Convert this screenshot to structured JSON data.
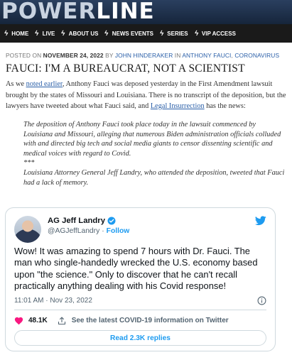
{
  "brand": {
    "part1": "POWER",
    "part2": "LINE"
  },
  "nav": {
    "items": [
      {
        "label": "HOME"
      },
      {
        "label": "LIVE"
      },
      {
        "label": "ABOUT US"
      },
      {
        "label": "NEWS EVENTS"
      },
      {
        "label": "SERIES"
      },
      {
        "label": "VIP ACCESS"
      }
    ]
  },
  "post": {
    "posted_on_prefix": "POSTED ON",
    "date": "NOVEMBER 24, 2022",
    "by": "BY",
    "author": "JOHN HINDERAKER",
    "in": "IN",
    "category1": "ANTHONY FAUCI",
    "comma": ",",
    "category2": "CORONAVIRUS",
    "title": "FAUCI: I'M A BUREAUCRAT, NOT A SCIENTIST",
    "intro_1": "As we",
    "intro_link1": "noted earlier",
    "intro_2": ", Anthony Fauci was deposed yesterday in the First Amendment lawsuit brought by the states of Missouri and Louisiana. There is no transcript of the deposition, but the lawyers have tweeted about what Fauci said, and",
    "intro_link2": "Legal Insurrection",
    "intro_3": "has the news:",
    "quote_1": "The deposition of Anthony Fauci took place today in the lawsuit commenced by Louisiana and Missouri, alleging that numerous Biden administration officials colluded with and directed big tech and social media giants to censor dissenting scientific and medical voices with regard to Covid.",
    "quote_sep": "***",
    "quote_2": "Louisiana Attorney General Jeff Landry, who attended the deposition, tweeted that Fauci had a lack of memory."
  },
  "tweet": {
    "name": "AG Jeff Landry",
    "handle": "@AGJeffLandry",
    "dot": "·",
    "follow": "Follow",
    "text": "Wow! It was amazing to spend 7 hours with Dr. Fauci. The man who single-handedly wrecked the U.S. economy based upon \"the science.\" Only to discover that he can't recall practically anything dealing with his Covid response!",
    "time": "11:01 AM · Nov 23, 2022",
    "likes": "48.1K",
    "covid_link": "See the latest COVID-19 information on Twitter",
    "read_replies": "Read 2.3K replies",
    "accent": "#1d9bf0"
  },
  "icons": {
    "nav_item": "bolt-icon",
    "verified": "verified-badge-icon",
    "bird": "twitter-bird-icon",
    "info": "info-icon",
    "like": "heart-icon",
    "share": "share-icon"
  }
}
